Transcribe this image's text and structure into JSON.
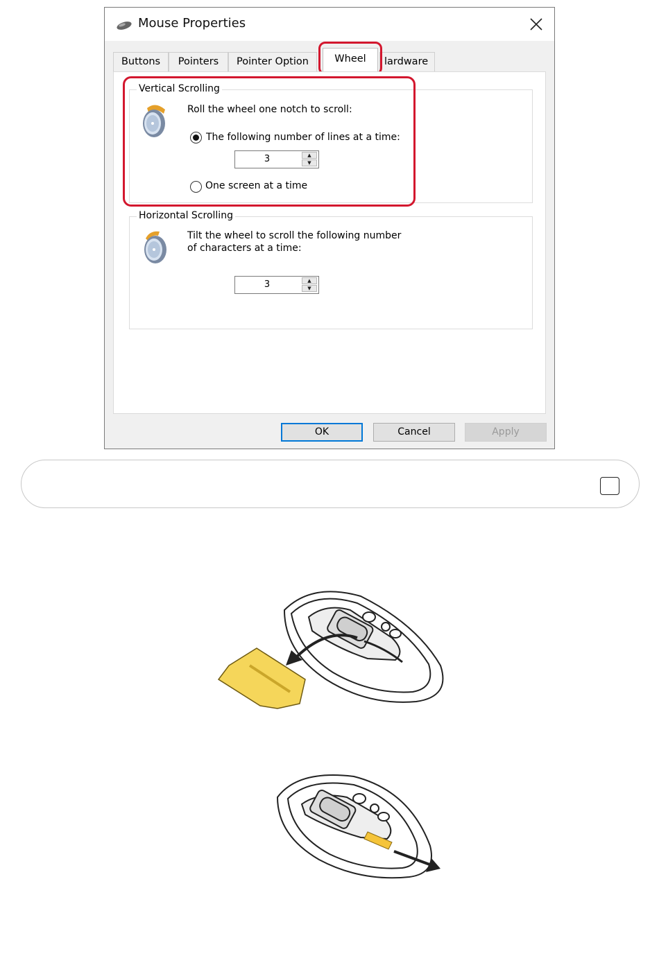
{
  "window": {
    "title": "Mouse Properties",
    "close_glyph": "✕"
  },
  "tabs": [
    {
      "label": "Buttons"
    },
    {
      "label": "Pointers"
    },
    {
      "label": "Pointer Option"
    },
    {
      "label": "Wheel",
      "active": true
    },
    {
      "label": "lardware"
    }
  ],
  "vertical": {
    "legend": "Vertical Scrolling",
    "instruction": "Roll the wheel one notch to scroll:",
    "option_lines": "The following number of lines at a time:",
    "lines_value": "3",
    "option_screen": "One screen at a time",
    "selected": "lines"
  },
  "horizontal": {
    "legend": "Horizontal Scrolling",
    "instruction_line1": "Tilt the wheel to scroll the following number",
    "instruction_line2": "of characters at a time:",
    "chars_value": "3"
  },
  "buttons": {
    "ok": "OK",
    "cancel": "Cancel",
    "apply": "Apply"
  },
  "colors": {
    "highlight": "#d3172e",
    "battery_cover": "#f5d65a",
    "default_button_border": "#0078d7"
  },
  "icons": [
    "mouse-icon",
    "close-icon",
    "wheel-icon",
    "checkbox-icon"
  ]
}
